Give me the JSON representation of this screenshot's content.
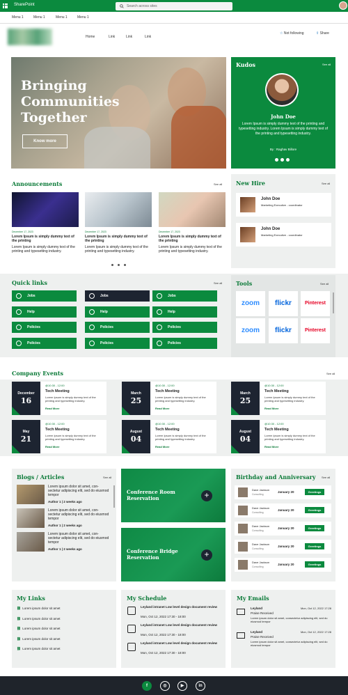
{
  "suite": {
    "app_name": "SharePoint",
    "search_placeholder": "Search across sites"
  },
  "menu": [
    "Menu 1",
    "Menu 1",
    "Menu 1",
    "Menu 1"
  ],
  "site_nav": {
    "links": [
      "Home",
      "Link",
      "Link",
      "Link"
    ],
    "not_following": "Not following",
    "share": "Share"
  },
  "hero": {
    "title_lines": [
      "Bringing",
      "Communities",
      "Together"
    ],
    "button": "Know more"
  },
  "kudos": {
    "title": "Kudos",
    "see_all": "See all",
    "name": "John Doe",
    "text": "Lorem Ipsum is simply dummy text of the printing and typesetting industry. Lorem Ipsum is simply dummy text of the printing and typesetting industry.",
    "by": "By : Raghav Billore"
  },
  "announcements": {
    "title": "Announcements",
    "see_all": "See all",
    "items": [
      {
        "date": "December 17, 2023",
        "headline": "Lorem Ipsum is simply dummy text of the printing",
        "body": "Lorem Ipsum is simply dummy text of the printing and typesetting industry."
      },
      {
        "date": "December 17, 2023",
        "headline": "Lorem Ipsum is simply dummy text of the printing",
        "body": "Lorem Ipsum is simply dummy text of the printing and typesetting industry."
      },
      {
        "date": "December 17, 2023",
        "headline": "Lorem Ipsum is simply dummy text of the printing",
        "body": "Lorem Ipsum is simply dummy text of the printing and typesetting industry."
      }
    ]
  },
  "new_hire": {
    "title": "New Hire",
    "see_all": "See all",
    "items": [
      {
        "name": "John Doe",
        "role": "Marketing Executive - coordinator"
      },
      {
        "name": "John Doe",
        "role": "Marketing Executive - coordinator"
      }
    ]
  },
  "quick_links": {
    "title": "Quick links",
    "see_all": "See all",
    "labels": [
      "Jobs",
      "Jobs",
      "Jobs",
      "Help",
      "Help",
      "Help",
      "Policies",
      "Policies",
      "Policies",
      "Policies",
      "Policies",
      "Policies"
    ]
  },
  "tools": {
    "title": "Tools",
    "see_all": "See all",
    "items": [
      "zoom",
      "flickr",
      "Pinterest",
      "zoom",
      "flickr",
      "Pinterest"
    ]
  },
  "events": {
    "title": "Company Events",
    "see_all": "See all",
    "items": [
      {
        "month": "December",
        "day": "16",
        "time": "@10:30 - 12:00",
        "title": "Tech Meeting",
        "desc": "Lorem Ipsum is simply dummy text of the printing and typesetting industry.",
        "link": "Read More"
      },
      {
        "month": "March",
        "day": "25",
        "time": "@10:30 - 12:00",
        "title": "Tech Meeting",
        "desc": "Lorem Ipsum is simply dummy text of the printing and typesetting industry.",
        "link": "Read More"
      },
      {
        "month": "March",
        "day": "25",
        "time": "@10:30 - 12:00",
        "title": "Tech Meeting",
        "desc": "Lorem Ipsum is simply dummy text of the printing and typesetting industry.",
        "link": "Read More"
      },
      {
        "month": "May",
        "day": "21",
        "time": "@10:30 - 12:00",
        "title": "Tech Meeting",
        "desc": "Lorem Ipsum is simply dummy text of the printing and typesetting industry.",
        "link": "Read More"
      },
      {
        "month": "August",
        "day": "04",
        "time": "@10:30 - 12:00",
        "title": "Tech Meeting",
        "desc": "Lorem Ipsum is simply dummy text of the printing and typesetting industry.",
        "link": "Read More"
      },
      {
        "month": "August",
        "day": "04",
        "time": "@10:30 - 12:00",
        "title": "Tech Meeting",
        "desc": "Lorem Ipsum is simply dummy text of the printing and typesetting industry.",
        "link": "Read More"
      }
    ]
  },
  "blogs": {
    "title": "Blogs / Articles",
    "see_all": "See all",
    "items": [
      {
        "text": "Lorem ipsum dolor sit amet, con-sectetur adipiscing elit, sed do eiusmod tempor",
        "meta": "Author 1  |  2 weeks ago"
      },
      {
        "text": "Lorem ipsum dolor sit amet, con-sectetur adipiscing elit, sed do eiusmod tempor",
        "meta": "Author 1  |  2 weeks ago"
      },
      {
        "text": "Lorem ipsum dolor sit amet, con-sectetur adipiscing elit, sed do eiusmod tempor",
        "meta": "Author 1  |  2 weeks ago"
      }
    ]
  },
  "reservations": [
    "Conference Room Reservation",
    "Conference Bridge Reservation"
  ],
  "birthdays": {
    "title": "Birthday and Anniversary",
    "see_all": "See all",
    "items": [
      {
        "name": "Dave Jackson",
        "dept": "Consulting",
        "date": "January 20",
        "btn": "Greetings"
      },
      {
        "name": "Dave Jackson",
        "dept": "Consulting",
        "date": "January 20",
        "btn": "Greetings"
      },
      {
        "name": "Dave Jackson",
        "dept": "Consulting",
        "date": "January 20",
        "btn": "Greetings"
      },
      {
        "name": "Dave Jackson",
        "dept": "Consulting",
        "date": "January 20",
        "btn": "Greetings"
      },
      {
        "name": "Dave Jackson",
        "dept": "Consulting",
        "date": "January 20",
        "btn": "Greetings"
      }
    ]
  },
  "my_links": {
    "title": "My Links",
    "items": [
      "Lorem ipsum dolor sit amet",
      "Lorem ipsum dolor sit amet",
      "Lorem ipsum dolor sit amet",
      "Lorem ipsum dolor sit amet",
      "Lorem ipsum dolor sit amet"
    ]
  },
  "my_schedule": {
    "title": "My Schedule",
    "items": [
      {
        "title": "Leyland intranet Low level design document review",
        "time": "Mon, Oct 12, 2022 17:30 - 18:00"
      },
      {
        "title": "Leyland intranet Low level design document review",
        "time": "Mon, Oct 12, 2022 17:30 - 18:00"
      },
      {
        "title": "Leyland intranet Low level design document review",
        "time": "Mon, Oct 12, 2022 17:30 - 18:00"
      }
    ]
  },
  "my_emails": {
    "title": "My Emails",
    "items": [
      {
        "from": "Leyland",
        "date": "Mon, Oct 12, 2022 17:28",
        "subject": "Praise Received",
        "preview": "Lorem ipsum dolor sit amet, consectetur adipiscing elit, sed do eiusmod tempor"
      },
      {
        "from": "Leyland",
        "date": "Mon, Oct 12, 2022 17:28",
        "subject": "Praise Received",
        "preview": "Lorem ipsum dolor sit amet, consectetur adipiscing elit, sed do eiusmod tempor"
      }
    ]
  },
  "footer": {
    "social": [
      "f",
      "◎",
      "▶",
      "in"
    ]
  }
}
